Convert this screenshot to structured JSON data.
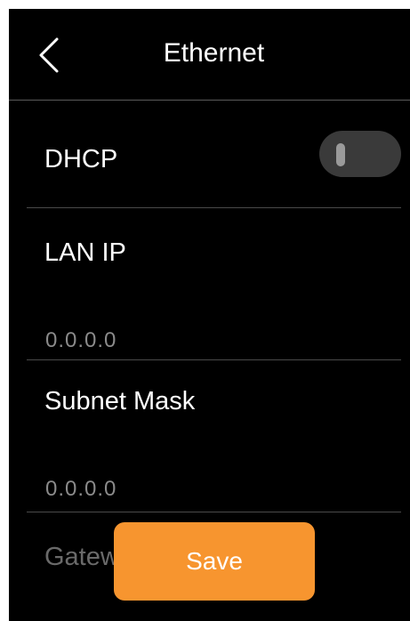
{
  "header": {
    "title": "Ethernet",
    "back_icon": "chevron-left-icon"
  },
  "settings": {
    "dhcp": {
      "label": "DHCP",
      "enabled": false
    },
    "lan_ip": {
      "label": "LAN IP",
      "value": "0.0.0.0"
    },
    "subnet_mask": {
      "label": "Subnet Mask",
      "value": "0.0.0.0"
    },
    "gateway": {
      "label": "Gateway"
    }
  },
  "actions": {
    "save_label": "Save"
  },
  "colors": {
    "background": "#000000",
    "accent": "#f7952f",
    "toggle_off": "#3a3a3a",
    "value_text": "#8a8a8a"
  }
}
